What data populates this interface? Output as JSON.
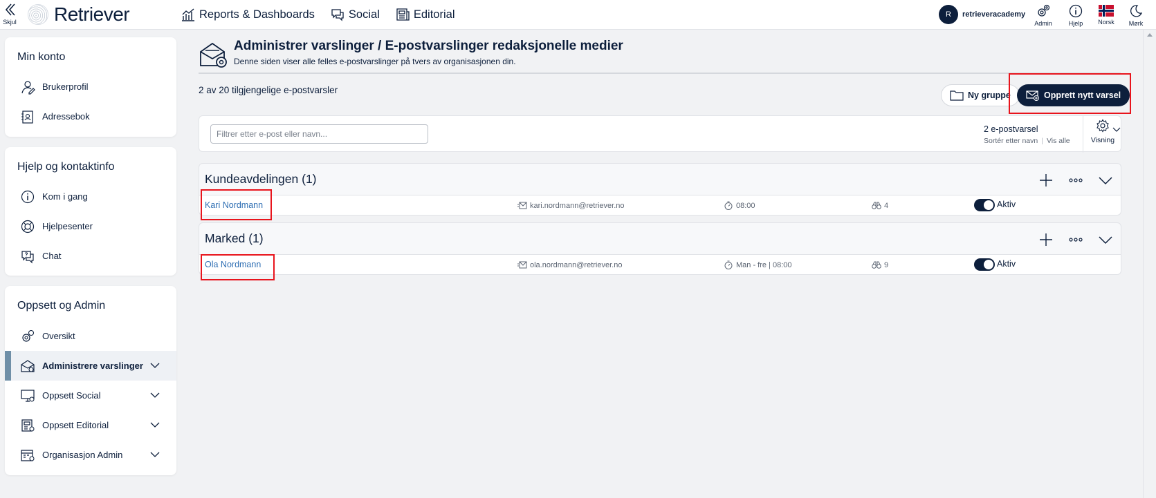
{
  "topbar": {
    "hide_label": "Skjul",
    "logo_text": "Retriever",
    "nav": [
      {
        "label": "Reports & Dashboards",
        "icon": "chart-icon"
      },
      {
        "label": "Social",
        "icon": "chat-bubbles-icon"
      },
      {
        "label": "Editorial",
        "icon": "newspaper-icon"
      }
    ],
    "user": {
      "initial": "R",
      "name": "retrieveracademy"
    },
    "tools": [
      {
        "label": "Admin",
        "icon": "gears-icon"
      },
      {
        "label": "Hjelp",
        "icon": "info-icon"
      },
      {
        "label": "Norsk",
        "icon": "norway-flag-icon"
      },
      {
        "label": "Mørk",
        "icon": "moon-icon"
      }
    ]
  },
  "sidebar": {
    "sections": [
      {
        "title": "Min konto",
        "items": [
          {
            "label": "Brukerprofil",
            "icon": "user-profile-icon"
          },
          {
            "label": "Adressebok",
            "icon": "address-book-icon"
          }
        ]
      },
      {
        "title": "Hjelp og kontaktinfo",
        "items": [
          {
            "label": "Kom i gang",
            "icon": "info-icon"
          },
          {
            "label": "Hjelpesenter",
            "icon": "lifebuoy-icon"
          },
          {
            "label": "Chat",
            "icon": "chat-question-icon"
          }
        ]
      },
      {
        "title": "Oppsett og Admin",
        "items": [
          {
            "label": "Oversikt",
            "icon": "gears-icon"
          },
          {
            "label": "Administrere varslinger",
            "icon": "mail-gear-icon",
            "active": true
          },
          {
            "label": "Oppsett Social",
            "icon": "monitor-gear-icon"
          },
          {
            "label": "Oppsett Editorial",
            "icon": "newspaper-gear-icon"
          },
          {
            "label": "Organisasjon Admin",
            "icon": "building-gear-icon"
          }
        ]
      }
    ]
  },
  "main": {
    "title": "Administrer varslinger / E-postvarslinger redaksjonelle medier",
    "subtitle": "Denne siden viser alle felles e-postvarslinger på tvers av organisasjonen din.",
    "count_text": "2 av 20 tilgjengelige e-postvarsler",
    "new_group_label": "Ny gruppe",
    "create_label": "Opprett nytt varsel",
    "filter": {
      "placeholder": "Filtrer etter e-post eller navn...",
      "count": "2 e-postvarsel",
      "sort_label": "Sortér etter navn",
      "show_all": "Vis alle",
      "view_label": "Visning"
    },
    "groups": [
      {
        "title": "Kundeavdelingen (1)",
        "rows": [
          {
            "name": "Kari Nordmann",
            "email": "kari.nordmann@retriever.no",
            "schedule": "08:00",
            "count": "4",
            "status": "Aktiv"
          }
        ]
      },
      {
        "title": "Marked (1)",
        "rows": [
          {
            "name": "Ola Nordmann",
            "email": "ola.nordmann@retriever.no",
            "schedule": "Man - fre | 08:00",
            "count": "9",
            "status": "Aktiv"
          }
        ]
      }
    ]
  },
  "colors": {
    "navy": "#0d1f3c",
    "link": "#2f6fb3",
    "highlight": "#e8141c",
    "active_bar": "#6f8fa7"
  }
}
